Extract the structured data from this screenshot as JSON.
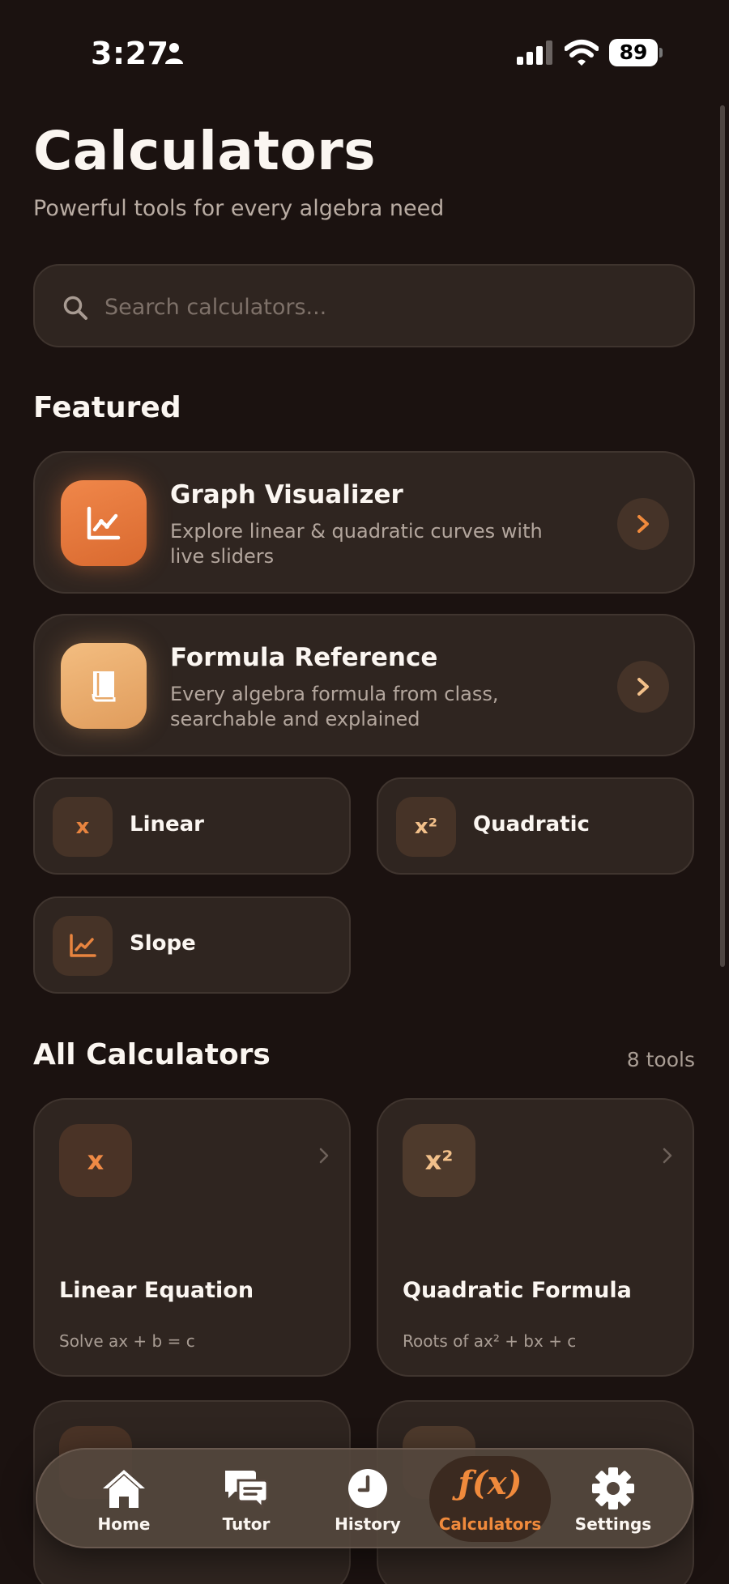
{
  "status": {
    "time": "3:27",
    "battery": "89"
  },
  "header": {
    "title": "Calculators",
    "subtitle": "Powerful tools for every algebra need"
  },
  "search": {
    "placeholder": "Search calculators..."
  },
  "featured": {
    "title": "Featured",
    "cards": [
      {
        "title": "Graph Visualizer",
        "description": "Explore linear & quadratic curves with live sliders",
        "icon": "chart-line-icon"
      },
      {
        "title": "Formula Reference",
        "description": "Every algebra formula from class, searchable and explained",
        "icon": "book-icon"
      }
    ],
    "quick": [
      {
        "icon_text": "x",
        "label": "Linear"
      },
      {
        "icon_text": "x²",
        "label": "Quadratic"
      },
      {
        "icon_text": "",
        "label": "Slope",
        "icon": "chart-line-icon"
      }
    ]
  },
  "all": {
    "title": "All Calculators",
    "count": "8 tools",
    "cards": [
      {
        "icon_text": "x",
        "title": "Linear Equation",
        "description": "Solve ax + b = c"
      },
      {
        "icon_text": "x²",
        "title": "Quadratic Formula",
        "description": "Roots of ax² + bx + c"
      },
      {
        "icon_text": "",
        "title": "",
        "description": ""
      },
      {
        "icon_text": "",
        "title": "",
        "description": ""
      }
    ]
  },
  "tabs": [
    {
      "label": "Home",
      "icon": "home-icon"
    },
    {
      "label": "Tutor",
      "icon": "chat-icon"
    },
    {
      "label": "History",
      "icon": "clock-icon"
    },
    {
      "label": "Calculators",
      "icon": "function-icon",
      "glyph": "ƒ(x)",
      "active": true
    },
    {
      "label": "Settings",
      "icon": "gear-icon"
    }
  ],
  "colors": {
    "background": "#1b1210",
    "accent": "#f08a3c",
    "card": "#2f2520"
  }
}
